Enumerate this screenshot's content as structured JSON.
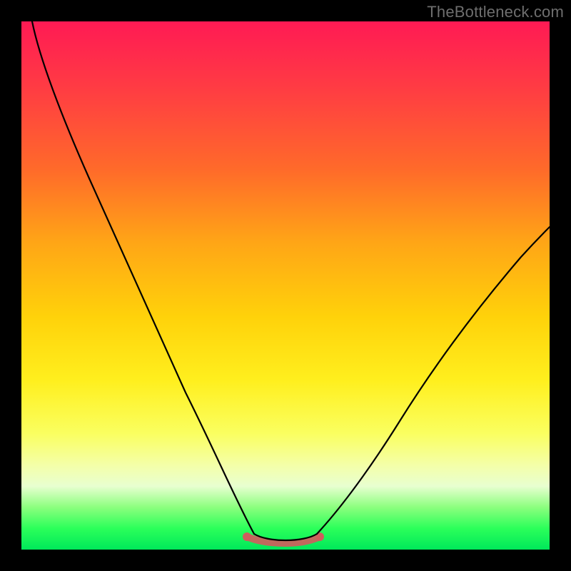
{
  "watermark": "TheBottleneck.com",
  "colors": {
    "page_bg": "#000000",
    "trough_stroke": "#cf5d5d",
    "curve_stroke": "#000000",
    "watermark_text": "#6e6e6e"
  },
  "chart_data": {
    "type": "line",
    "title": "",
    "xlabel": "",
    "ylabel": "",
    "xlim": [
      0,
      100
    ],
    "ylim": [
      0,
      100
    ],
    "grid": false,
    "legend": false,
    "annotations": [
      {
        "text": "trough-highlight",
        "x_range": [
          42,
          56
        ],
        "y": 2
      }
    ],
    "series": [
      {
        "name": "left-descent",
        "x": [
          2,
          5,
          10,
          15,
          20,
          25,
          30,
          35,
          38,
          40,
          42,
          44
        ],
        "values": [
          100,
          92,
          80,
          70,
          60,
          50,
          38,
          24,
          15,
          9,
          5,
          3
        ]
      },
      {
        "name": "bottleneck-trough",
        "x": [
          44,
          46,
          48,
          50,
          52,
          54,
          56
        ],
        "values": [
          3,
          2,
          1.5,
          1.5,
          1.5,
          2,
          3
        ]
      },
      {
        "name": "right-ascent",
        "x": [
          56,
          60,
          65,
          70,
          75,
          80,
          85,
          90,
          95,
          100
        ],
        "values": [
          3,
          6,
          11,
          18,
          25,
          32,
          40,
          48,
          55,
          61
        ]
      }
    ]
  }
}
